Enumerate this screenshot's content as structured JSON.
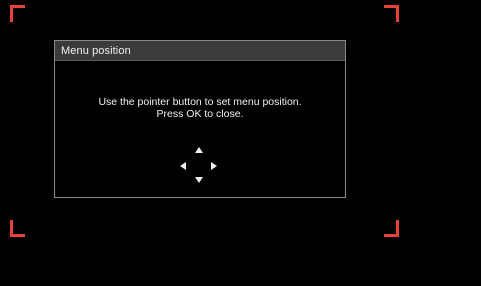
{
  "dialog": {
    "title": "Menu position",
    "message_line1": "Use the pointer button to set menu position.",
    "message_line2": "Press OK to close."
  },
  "pointer": {
    "icons": [
      "arrow-up-icon",
      "arrow-down-icon",
      "arrow-left-icon",
      "arrow-right-icon"
    ]
  },
  "colors": {
    "background": "#000000",
    "corner_marker": "#e8413a",
    "dialog_header": "#3b3b3b",
    "dialog_border": "#8a8a8a",
    "text": "#f2f2f2"
  }
}
